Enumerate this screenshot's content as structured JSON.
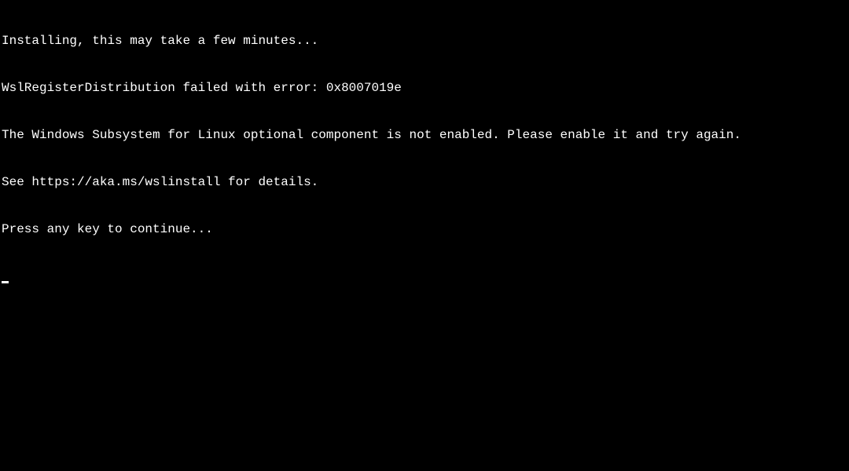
{
  "terminal": {
    "lines": [
      "Installing, this may take a few minutes...",
      "WslRegisterDistribution failed with error: 0x8007019e",
      "The Windows Subsystem for Linux optional component is not enabled. Please enable it and try again.",
      "See https://aka.ms/wslinstall for details.",
      "Press any key to continue..."
    ]
  }
}
